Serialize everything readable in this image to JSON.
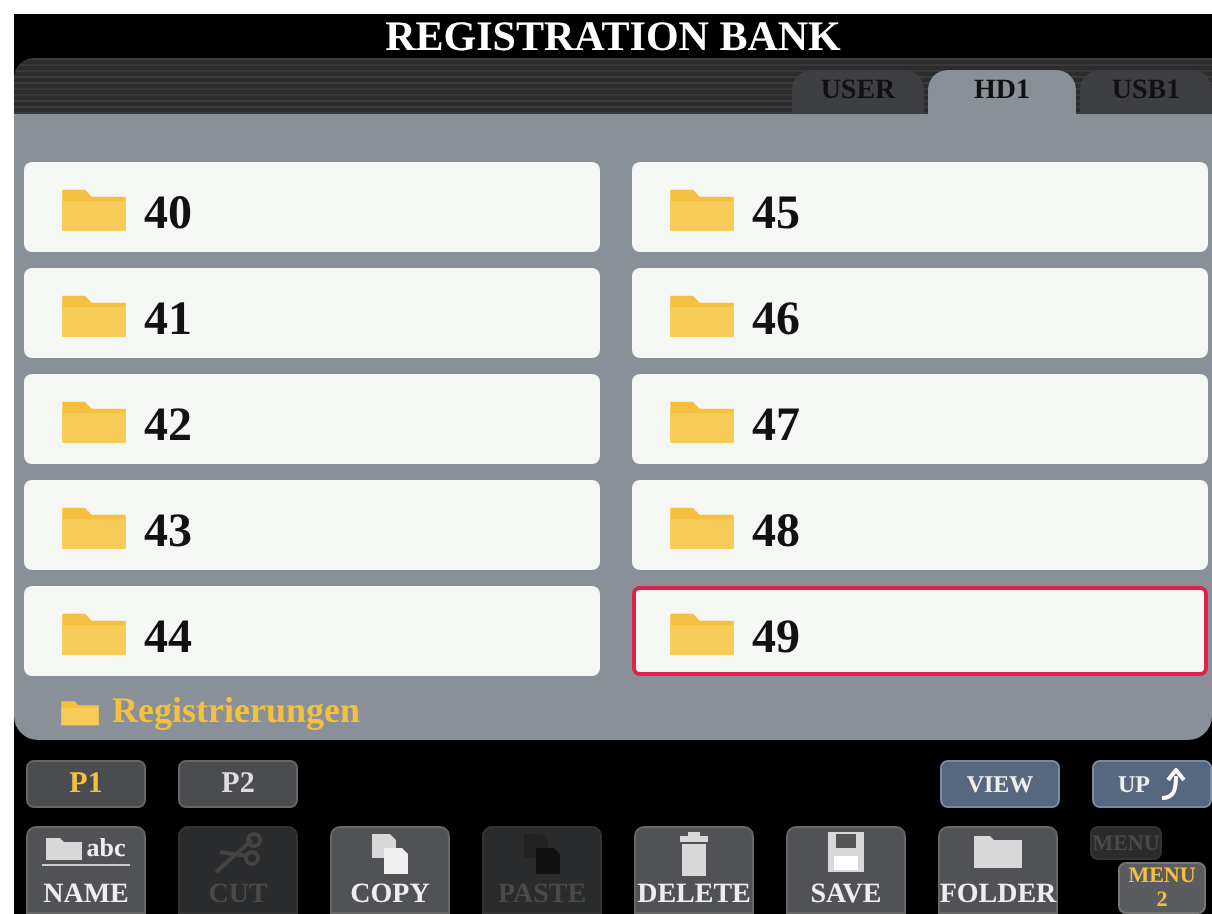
{
  "title": "REGISTRATION BANK",
  "tabs": [
    {
      "label": "USER",
      "selected": false
    },
    {
      "label": "HD1",
      "selected": true
    },
    {
      "label": "USB1",
      "selected": false
    }
  ],
  "folders": [
    {
      "name": "40",
      "selected": false
    },
    {
      "name": "41",
      "selected": false
    },
    {
      "name": "42",
      "selected": false
    },
    {
      "name": "43",
      "selected": false
    },
    {
      "name": "44",
      "selected": false
    },
    {
      "name": "45",
      "selected": false
    },
    {
      "name": "46",
      "selected": false
    },
    {
      "name": "47",
      "selected": false
    },
    {
      "name": "48",
      "selected": false
    },
    {
      "name": "49",
      "selected": true
    }
  ],
  "current_path": "Registrierungen",
  "pages": [
    {
      "label": "P1",
      "selected": true
    },
    {
      "label": "P2",
      "selected": false
    }
  ],
  "view_button": "VIEW",
  "up_button": "UP",
  "actions": [
    {
      "kind": "name",
      "icon_text": "abc",
      "label": "NAME",
      "disabled": false
    },
    {
      "kind": "cut",
      "label": "CUT",
      "disabled": true
    },
    {
      "kind": "copy",
      "label": "COPY",
      "disabled": false
    },
    {
      "kind": "paste",
      "label": "PASTE",
      "disabled": true
    },
    {
      "kind": "delete",
      "label": "DELETE",
      "disabled": false
    },
    {
      "kind": "save",
      "label": "SAVE",
      "disabled": false
    },
    {
      "kind": "folder",
      "label": "FOLDER",
      "disabled": false
    }
  ],
  "menus": [
    {
      "label": "MENU",
      "selected": false
    },
    {
      "label": "MENU",
      "number": "2",
      "selected": true
    }
  ]
}
